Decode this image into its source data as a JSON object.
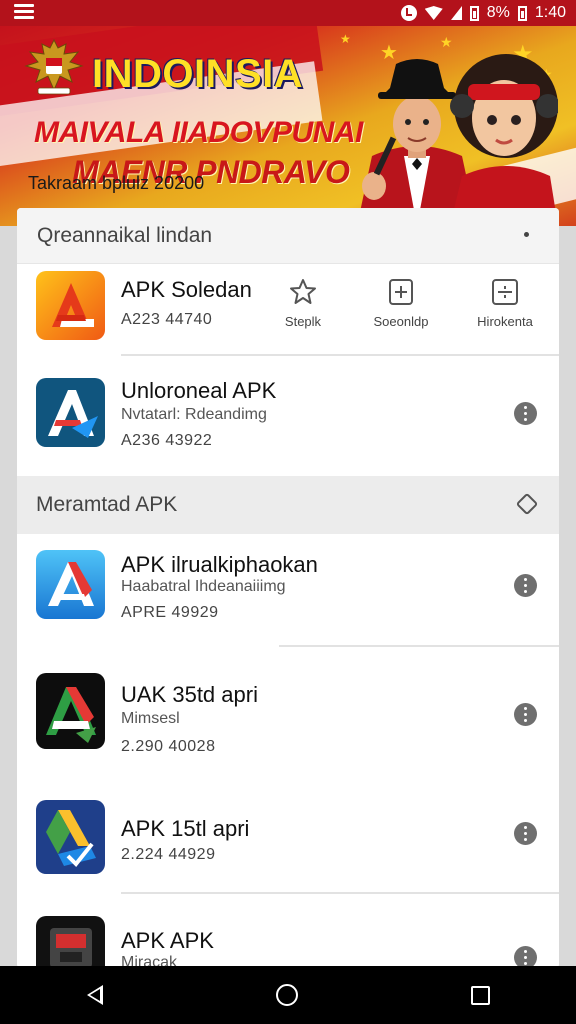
{
  "status_bar": {
    "battery": "8%",
    "time": "1:40"
  },
  "banner": {
    "title": "INDOINSIA",
    "subtitle_line1": "MAIVALA IIADOVPUNAI",
    "subtitle_line2": "MAENR PNDRAVO",
    "date_line": "Takraam bplulz 20200"
  },
  "list_header": {
    "title": "Qreannaikal lindan"
  },
  "featured_app": {
    "name": "APK Soledan",
    "meta": "A223 44740",
    "actions": [
      {
        "label": "Steplk",
        "icon": "star-icon"
      },
      {
        "label": "Soeonldp",
        "icon": "plus-box-icon"
      },
      {
        "label": "Hirokenta",
        "icon": "minus-box-icon"
      }
    ]
  },
  "apps_top": [
    {
      "name": "Unloroneal APK",
      "subtitle": "Nvtatarl: Rdeandimg",
      "meta": "A236 43922"
    }
  ],
  "section": {
    "title": "Meramtad APK"
  },
  "apps": [
    {
      "name": "APK ilrualkiphaokan",
      "subtitle": "Haabatral Ihdeanaiiimg",
      "meta": "APRE 49929"
    },
    {
      "name": "UAK 35td apri",
      "subtitle": "Mimsesl",
      "meta": "2.290 40028"
    },
    {
      "name": "APK 15tl apri",
      "subtitle": "",
      "meta": "2.224 44929"
    },
    {
      "name": "APK APK",
      "subtitle": "Miracak",
      "meta": ""
    }
  ],
  "colors": {
    "brand_red": "#c4121c",
    "gold": "#f0c025",
    "accent_blue": "#1e88e5"
  }
}
